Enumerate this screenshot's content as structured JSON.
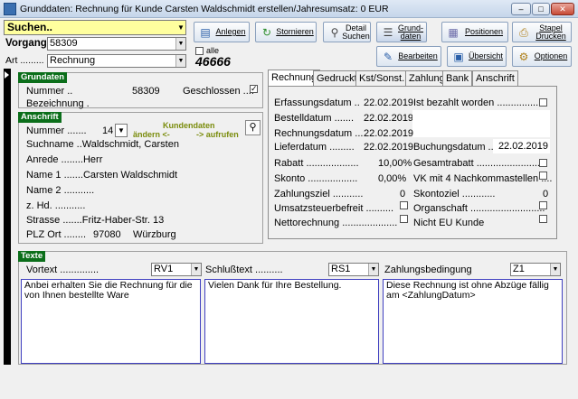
{
  "window": {
    "title": "Grunddaten: Rechnung für Kunde Carsten Waldschmidt erstellen/Jahresumsatz: 0 EUR",
    "minimize_label": "–",
    "maximize_label": "□",
    "close_label": "✕"
  },
  "top": {
    "search_label": "Suchen..",
    "vorgang_label": "Vorgang",
    "vorgang_value": "58309",
    "art_label": "Art .........",
    "art_value": "Rechnung",
    "alle_label": "alle",
    "count_value": "46666"
  },
  "toolbar": {
    "anlegen": "Anlegen",
    "stornieren": "Stornieren",
    "detail_suchen": "Detail Suchen",
    "grunddaten": "Grund-daten",
    "positionen": "Positionen",
    "stapel_drucken": "Stapel Drucken",
    "bearbeiten": "Bearbeiten",
    "uebersicht": "Übersicht",
    "optionen": "Optionen"
  },
  "grunddaten": {
    "header": "Grundaten",
    "nummer_label": "Nummer ..",
    "nummer_value": "58309",
    "geschlossen_label": "Geschlossen ....",
    "geschlossen_check": "✓",
    "bezeichnung_label": "Bezeichnung ."
  },
  "anschrift": {
    "header": "Anschrift",
    "nummer_label": "Nummer .......",
    "nummer_value": "14",
    "kundendaten_label": "Kundendaten",
    "aendern_label": "ändern <-",
    "aufrufen_label": "-> aufrufen",
    "suchname": "Suchname ..Waldschmidt, Carsten",
    "anrede": "Anrede ........Herr",
    "name1": "Name 1 .......Carsten Waldschmidt",
    "name2": "Name 2 ...........",
    "zhd": "z. Hd. ...........",
    "strasse": "Strasse .......Fritz-Haber-Str. 13",
    "plz_label": "PLZ  Ort ........",
    "plz_value": "97080",
    "ort_value": "Würzburg"
  },
  "tabs": [
    "Rechnung",
    "Gedruckt",
    "Kst/Sonst.",
    "Zahlung",
    "Bank",
    "Anschrift"
  ],
  "rechnung": {
    "erfassungsdatum_label": "Erfassungsdatum ..",
    "erfassungsdatum_value": "22.02.2019",
    "ist_bezahlt_label": "Ist bezahlt worden .................",
    "bestelldatum_label": "Bestelldatum .......",
    "bestelldatum_value": "22.02.2019",
    "rechnungsdatum_label": "Rechnungsdatum ...",
    "rechnungsdatum_value": "22.02.2019",
    "lieferdatum_label": "Lieferdatum .........",
    "lieferdatum_value": "22.02.2019",
    "buchungsdatum_label": "Buchungsdatum ...",
    "buchungsdatum_value": "22.02.2019",
    "rabatt_label": "Rabatt ...................",
    "rabatt_value": "10,00%",
    "gesamtrabatt_label": "Gesamtrabatt .........................",
    "skonto_label": "Skonto ..................",
    "skonto_value": "0,00%",
    "vk4_label": "VK mit 4 Nachkommastellen ....",
    "zahlungsziel_label": "Zahlungsziel ...........",
    "zahlungsziel_value": "0",
    "skontoziel_label": "Skontoziel ............",
    "skontoziel_value": "0",
    "ust_label": "Umsatzsteuerbefreit ..........",
    "organschaft_label": "Organschaft ...........................",
    "netto_label": "Nettorechnung ....................",
    "nicht_eu_label": "Nicht EU Kunde"
  },
  "texte": {
    "header": "Texte",
    "vortext_label": "Vortext ..............",
    "vortext_code": "RV1",
    "schlusstext_label": "Schlußtext ..........",
    "schlusstext_code": "RS1",
    "zahlungsbedingung_label": "Zahlungsbedingung",
    "zahlungsbedingung_code": "Z1",
    "vortext": "Anbei erhalten Sie die Rechnung für die von Ihnen bestellte Ware",
    "schlusstext": "Vielen Dank für Ihre Bestellung.",
    "zahlungstext": "Diese Rechnung ist ohne Abzüge fällig am  <ZahlungDatum>"
  }
}
